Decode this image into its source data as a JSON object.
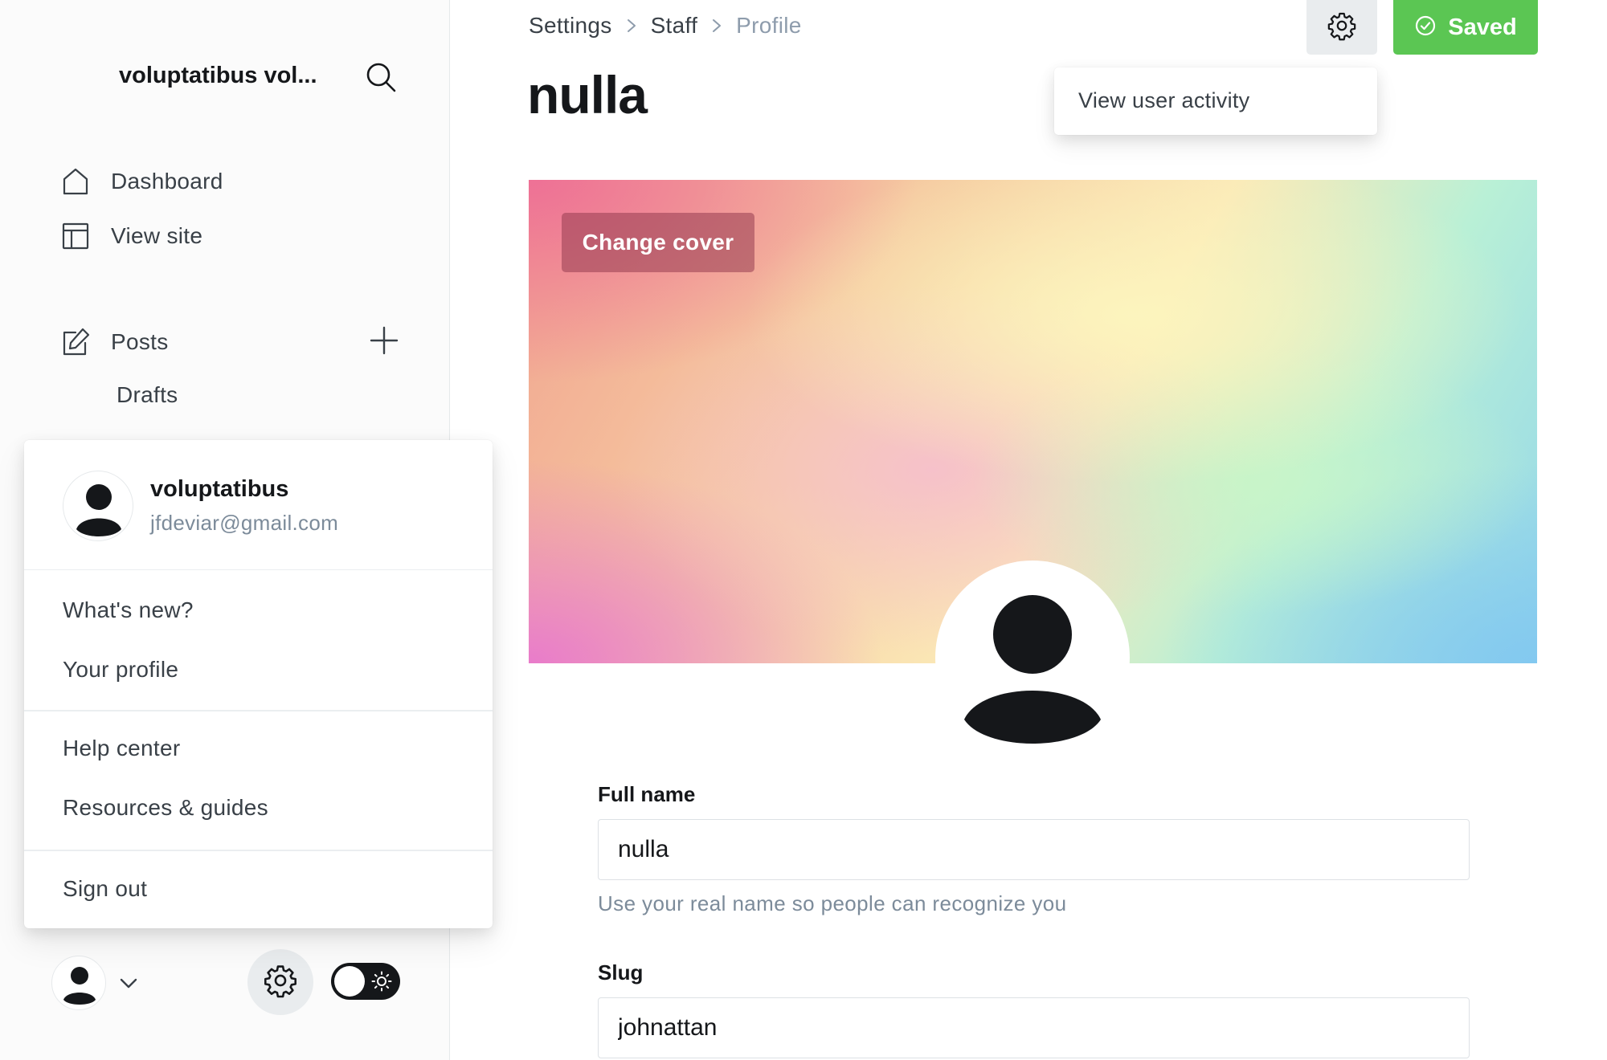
{
  "sidebar": {
    "site_title": "voluptatibus vol...",
    "nav": [
      {
        "label": "Dashboard",
        "icon": "home-icon"
      },
      {
        "label": "View site",
        "icon": "layout-icon"
      },
      {
        "label": "Posts",
        "icon": "edit-icon"
      },
      {
        "label": "Drafts"
      }
    ],
    "posts_add_icon": "plus-icon",
    "search_icon": "search-icon"
  },
  "user_menu": {
    "name": "voluptatibus",
    "email": "jfdeviar@gmail.com",
    "items": [
      "What's new?",
      "Your profile",
      "Help center",
      "Resources & guides",
      "Sign out"
    ]
  },
  "sidebar_footer": {
    "avatar_icon": "user-avatar-icon",
    "chevron_icon": "chevron-down-icon",
    "settings_icon": "gear-icon",
    "theme_toggle": {
      "state": "dark",
      "icon": "sun-icon"
    }
  },
  "header": {
    "breadcrumb": [
      "Settings",
      "Staff",
      "Profile"
    ],
    "title": "nulla",
    "saved_label": "Saved",
    "activity_menu_item": "View user activity"
  },
  "cover": {
    "change_cover_label": "Change cover"
  },
  "form": {
    "full_name_label": "Full name",
    "full_name_value": "nulla",
    "full_name_hint": "Use your real name so people can recognize you",
    "slug_label": "Slug",
    "slug_value": "johnattan"
  },
  "colors": {
    "accent_green": "#5bc653",
    "text_dark": "#15171a",
    "text_muted": "#7c8b9a"
  }
}
